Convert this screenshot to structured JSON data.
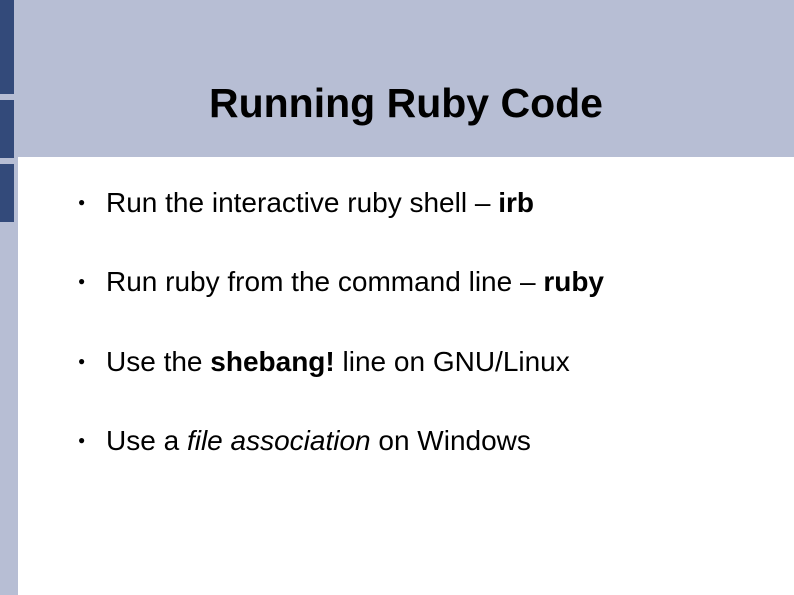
{
  "title": "Running Ruby Code",
  "bullets": [
    {
      "prefix": "Run the interactive ruby shell – ",
      "em": "irb",
      "emStyle": "bold",
      "suffix": ""
    },
    {
      "prefix": "Run ruby from the command line – ",
      "em": "ruby",
      "emStyle": "bold",
      "suffix": ""
    },
    {
      "prefix": "Use the ",
      "em": "shebang!",
      "emStyle": "bold",
      "suffix": " line on GNU/Linux"
    },
    {
      "prefix": "Use a ",
      "em": "file association",
      "emStyle": "italic",
      "suffix": " on Windows"
    }
  ]
}
